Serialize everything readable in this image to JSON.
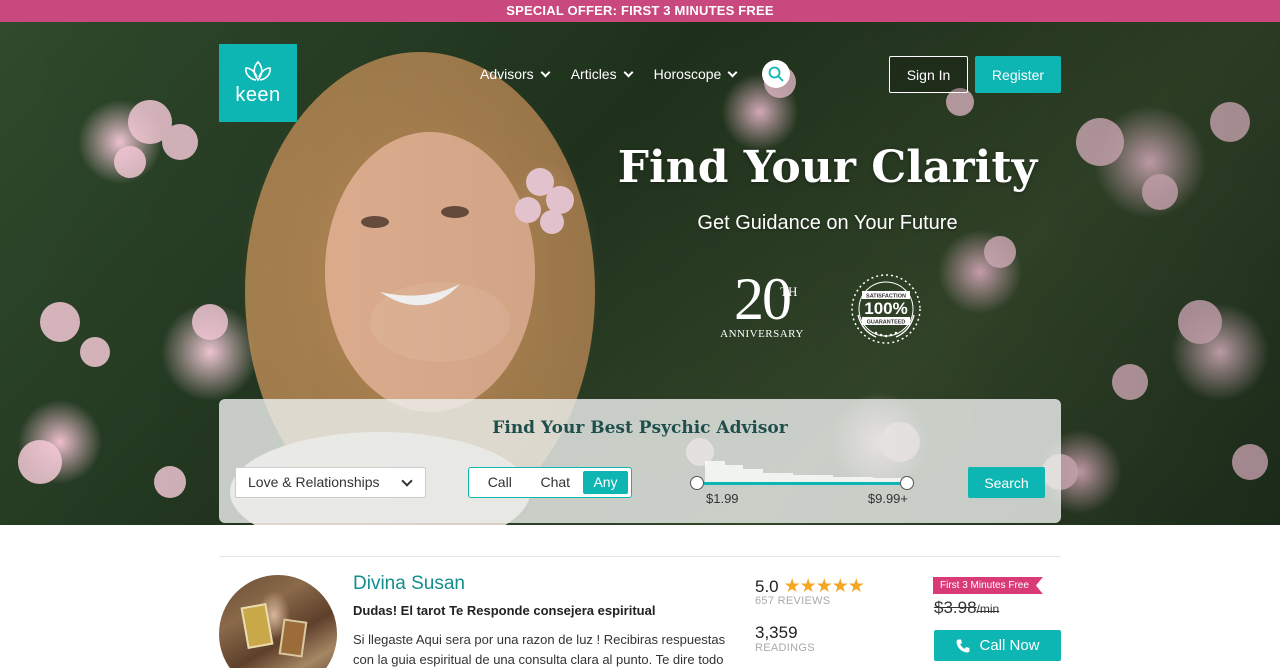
{
  "promo": {
    "text": "SPECIAL OFFER: FIRST 3 MINUTES FREE"
  },
  "header": {
    "logo_text": "keen",
    "nav": [
      {
        "label": "Advisors"
      },
      {
        "label": "Articles"
      },
      {
        "label": "Horoscope"
      }
    ],
    "sign_in_label": "Sign In",
    "register_label": "Register"
  },
  "hero": {
    "title": "Find Your Clarity",
    "subtitle": "Get Guidance on Your Future",
    "badge_anniversary": {
      "number": "20",
      "suffix": "TH",
      "label": "ANNIVERSARY"
    },
    "badge_satisfaction": {
      "top": "SATISFACTION",
      "value": "100%",
      "bottom": "GUARANTEED"
    }
  },
  "search": {
    "title": "Find Your Best Psychic Advisor",
    "category_selected": "Love & Relationships",
    "modes": [
      "Call",
      "Chat",
      "Any"
    ],
    "active_mode": "Any",
    "price_min": "$1.99",
    "price_max": "$9.99+",
    "search_label": "Search"
  },
  "advisor": {
    "name": "Divina Susan",
    "tagline": "Dudas! El tarot Te Responde consejera espiritual",
    "description": "Si llegaste Aqui sera por una razon de luz ! Recibiras respuestas con la guia espiritual de una consulta clara al punto. Te dire todo para que",
    "rating": "5.0",
    "stars": "★★★★★",
    "reviews": "657 REVIEWS",
    "readings_count": "3,359",
    "readings_label": "READINGS",
    "offer": "First 3 Minutes Free",
    "old_price": "$3.98",
    "price_unit": "/min",
    "call_label": "Call Now"
  },
  "colors": {
    "accent": "#0eb6b3",
    "promo": "#c9497f",
    "offer": "#d93a78",
    "star": "#f5a623"
  }
}
